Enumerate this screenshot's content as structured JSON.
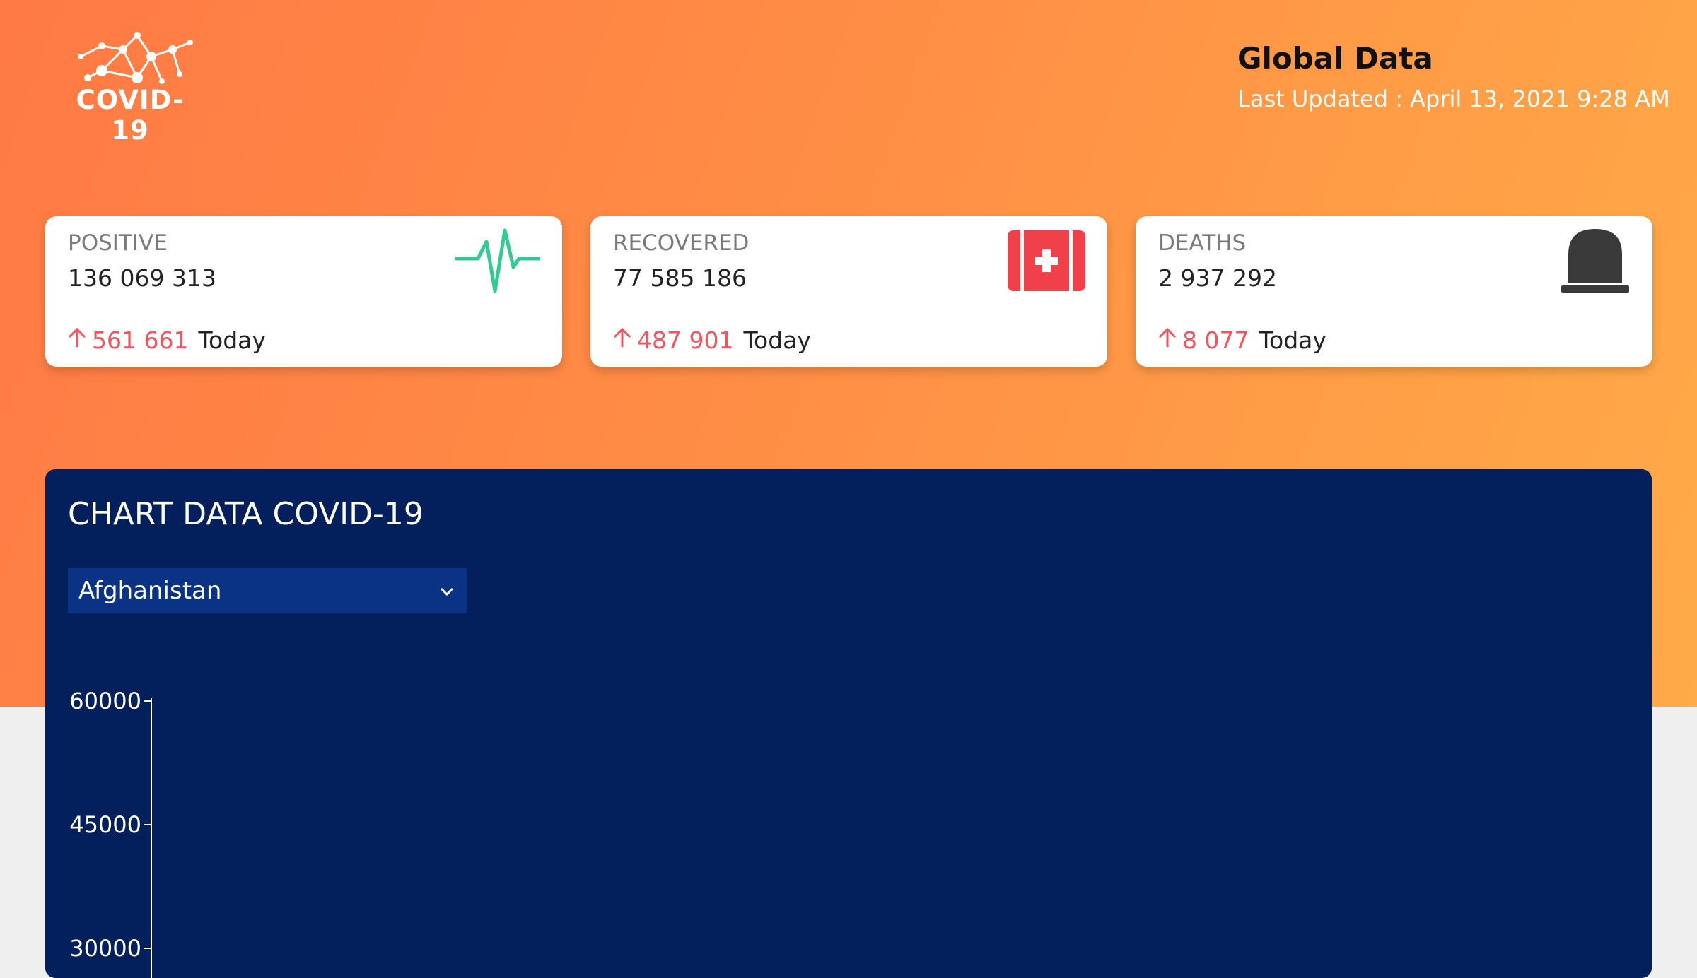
{
  "header": {
    "logo_text": "COVID-19",
    "title": "Global Data",
    "last_updated": "Last Updated : April 13, 2021 9:28 AM"
  },
  "cards": [
    {
      "label": "POSITIVE",
      "value": "136 069 313",
      "delta": "561 661",
      "suffix": "Today",
      "icon": "heartbeat-icon",
      "icon_color": "#2ecc8f"
    },
    {
      "label": "RECOVERED",
      "value": "77 585 186",
      "delta": "487 901",
      "suffix": "Today",
      "icon": "medical-kit-icon",
      "icon_color": "#f0404a"
    },
    {
      "label": "DEATHS",
      "value": "2 937 292",
      "delta": "8 077",
      "suffix": "Today",
      "icon": "tombstone-icon",
      "icon_color": "#3a3a3a"
    }
  ],
  "colors": {
    "delta": "#f2555d",
    "panel": "#03205c",
    "select": "#0a3285",
    "gradient_start": "#ff7a45",
    "gradient_end": "#ffab48"
  },
  "chart_section": {
    "title": "CHART DATA COVID-19",
    "selected_country": "Afghanistan",
    "y_ticks": [
      "60000",
      "45000",
      "30000"
    ]
  },
  "chart_data": {
    "type": "line",
    "title": "",
    "y_tick_labels": [
      "60000",
      "45000",
      "30000"
    ],
    "ylim_visible": [
      30000,
      60000
    ],
    "series": []
  }
}
